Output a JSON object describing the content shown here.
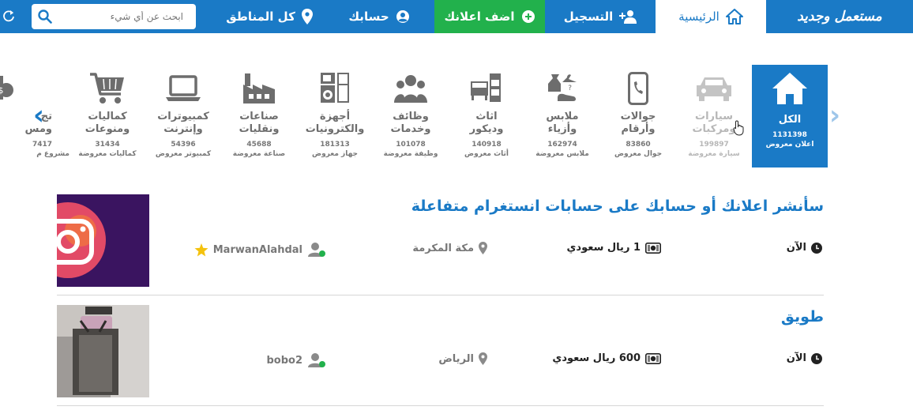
{
  "nav": {
    "logo": "مستعمل وجديد",
    "home": "الرئيسية",
    "register": "التسجيل",
    "add_ad": "اضف اعلانك",
    "account": "حسابك",
    "regions": "كل المناطق",
    "search_placeholder": "ابحث عن أي شيء"
  },
  "categories": [
    {
      "name": "الكل",
      "count": "1131398",
      "sub": "اعلان معروض",
      "icon": "home-icon"
    },
    {
      "name": "سيارات\nومركبات",
      "count": "199897",
      "sub": "سيارة معروضة",
      "icon": "car-icon"
    },
    {
      "name": "جوالات\nوأرقام",
      "count": "83860",
      "sub": "جوال معروض",
      "icon": "phone-icon"
    },
    {
      "name": "ملابس\nوأزياء",
      "count": "162974",
      "sub": "ملابس معروضة",
      "icon": "clothes-icon"
    },
    {
      "name": "اثاث\nوديكور",
      "count": "140918",
      "sub": "أثاث معروض",
      "icon": "furniture-icon"
    },
    {
      "name": "وظائف\nوخدمات",
      "count": "101078",
      "sub": "وظيفة معروضة",
      "icon": "people-icon"
    },
    {
      "name": "أجهزة\nوالكترونيات",
      "count": "181313",
      "sub": "جهاز معروض",
      "icon": "appliance-icon"
    },
    {
      "name": "صناعات\nونقليات",
      "count": "45688",
      "sub": "صناعة معروضة",
      "icon": "factory-icon"
    },
    {
      "name": "كمبيوترات\nوإنترنت",
      "count": "54396",
      "sub": "كمبيوتر معروض",
      "icon": "laptop-icon"
    },
    {
      "name": "كماليات\nومنوعات",
      "count": "31434",
      "sub": "كماليات معروضة",
      "icon": "cart-icon"
    },
    {
      "name": "تج\nومس",
      "count": "7417",
      "sub": "مشروع م",
      "icon": "money-icon"
    }
  ],
  "listings": [
    {
      "title": "سأنشر اعلانك أو حسابك على حسابات انستغرام متفاعلة",
      "time": "الآن",
      "price": "1 ريال سعودي",
      "location": "مكة المكرمة",
      "user": "MarwanAlahdal"
    },
    {
      "title": "طويق",
      "time": "الآن",
      "price": "600 ريال سعودي",
      "location": "الرياض",
      "user": "bobo2"
    }
  ],
  "colors": {
    "brand": "#1a7ac6",
    "add_button": "#22b14c",
    "online": "#22b14c",
    "star": "#f4c20d"
  }
}
